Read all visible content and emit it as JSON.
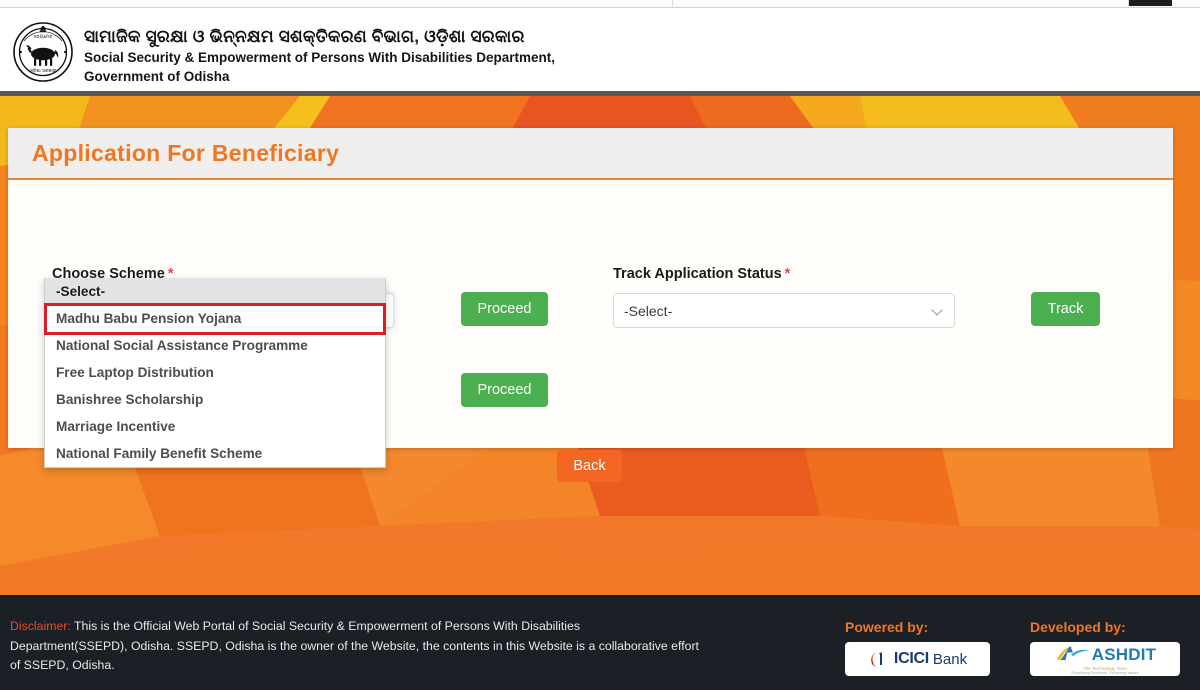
{
  "header": {
    "odia_title": "ସାମାଜିକ ସୁରକ୍ଷା ଓ ଭିନ୍ନକ୍ଷମ ସଶକ୍ତିକରଣ ବିଭାଗ, ଓଡ଼ିଶା  ସରକାର",
    "english_line1": "Social Security & Empowerment of Persons With Disabilities Department,",
    "english_line2": "Government of Odisha",
    "emblem_name": "odisha-state-emblem"
  },
  "card": {
    "title": "Application For Beneficiary"
  },
  "form": {
    "scheme_label": "Choose Scheme",
    "scheme_required_mark": "*",
    "scheme_value": "-Select-",
    "track_label": "Track Application Status",
    "track_required_mark": "*",
    "track_value": "-Select-",
    "proceed_label": "Proceed",
    "proceed2_label": "Proceed",
    "track_button_label": "Track",
    "back_label": "Back"
  },
  "dropdown": {
    "open": true,
    "highlighted_index": 1,
    "options": [
      "-Select-",
      "Madhu Babu Pension Yojana",
      "National Social Assistance Programme",
      "Free Laptop Distribution",
      "Banishree Scholarship",
      "Marriage Incentive",
      "National Family Benefit Scheme"
    ]
  },
  "footer": {
    "disclaimer_label": "Disclaimer:",
    "disclaimer_text": " This is the Official Web Portal of Social Security & Empowerment of Persons With Disabilities Department(SSEPD), Odisha. SSEPD, Odisha is the owner of the Website, the contents in this Website is a collaborative effort of SSEPD, Odisha.",
    "powered_by_title": "Powered by:",
    "powered_by_logo_primary": "ICICI",
    "powered_by_logo_secondary": "Bank",
    "developed_by_title": "Developed by:",
    "developed_by_logo": "ASHDIT",
    "developed_by_tagline": "The Technology Guru",
    "developed_by_tagline2": "Simplifying Solutions, Delivering Values"
  },
  "colors": {
    "accent_orange": "#ef7622",
    "green_button": "#4caf50",
    "orange_button": "#f26522",
    "highlight_red": "#d81f26",
    "footer_bg": "#1b2026",
    "required_red": "#e04a4a"
  }
}
